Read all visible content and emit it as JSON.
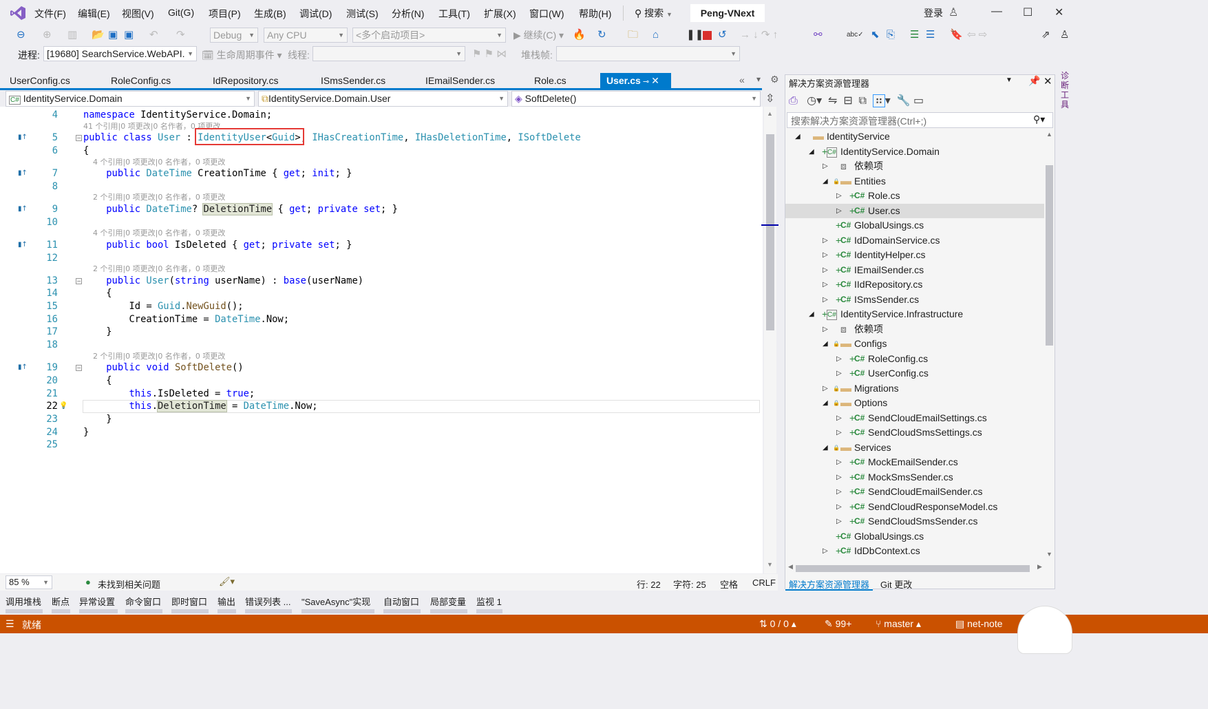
{
  "colors": {
    "accent": "#007acc",
    "status_bar": "#ca5100",
    "keyword": "#0000ff",
    "type": "#2b91af",
    "highlight_box": "#e53935"
  },
  "menu": [
    "文件(F)",
    "编辑(E)",
    "视图(V)",
    "Git(G)",
    "项目(P)",
    "生成(B)",
    "调试(D)",
    "测试(S)",
    "分析(N)",
    "工具(T)",
    "扩展(X)",
    "窗口(W)",
    "帮助(H)"
  ],
  "search_label": "搜索",
  "window_title": "Peng-VNext",
  "login": "登录",
  "toolbar": {
    "config": "Debug",
    "platform": "Any CPU",
    "startup": "<多个启动项目>",
    "continue": "继续(C)"
  },
  "debugbar": {
    "process_label": "进程:",
    "process_value": "[19680] SearchService.WebAPI.",
    "lifecycle": "生命周期事件",
    "thread_label": "线程:",
    "stackframe_label": "堆栈帧:"
  },
  "tabs": [
    {
      "label": "UserConfig.cs"
    },
    {
      "label": "RoleConfig.cs"
    },
    {
      "label": "IdRepository.cs"
    },
    {
      "label": "ISmsSender.cs"
    },
    {
      "label": "IEmailSender.cs"
    },
    {
      "label": "Role.cs"
    },
    {
      "label": "User.cs",
      "active": true
    }
  ],
  "navbar": {
    "project": "IdentityService.Domain",
    "type": "IdentityService.Domain.User",
    "member": "SoftDelete()"
  },
  "code": [
    {
      "n": 4,
      "tokens": [
        [
          "k",
          "namespace"
        ],
        [
          "p",
          " IdentityService.Domain;"
        ]
      ]
    },
    {
      "lens": "41 个引用|0 项更改|0 名作者，0 项更改",
      "n": 5,
      "icon": "implements",
      "fold": true,
      "tokens": [
        [
          "k",
          "public"
        ],
        [
          "p",
          " "
        ],
        [
          "k",
          "class"
        ],
        [
          "p",
          " "
        ],
        [
          "t",
          "User"
        ],
        [
          "p",
          " : "
        ],
        [
          "t",
          "IdentityUser"
        ],
        [
          "p",
          "<"
        ],
        [
          "t",
          "Guid"
        ],
        [
          "p",
          ">, "
        ],
        [
          "t",
          "IHasCreationTime"
        ],
        [
          "p",
          ", "
        ],
        [
          "t",
          "IHasDeletionTime"
        ],
        [
          "p",
          ", "
        ],
        [
          "t",
          "ISoftDelete"
        ]
      ]
    },
    {
      "n": 6,
      "tokens": [
        [
          "p",
          "{"
        ]
      ]
    },
    {
      "lens": "    4 个引用|0 项更改|0 名作者，0 项更改",
      "n": 7,
      "icon": "implements",
      "tokens": [
        [
          "p",
          "    "
        ],
        [
          "k",
          "public"
        ],
        [
          "p",
          " "
        ],
        [
          "t",
          "DateTime"
        ],
        [
          "p",
          " CreationTime { "
        ],
        [
          "k",
          "get"
        ],
        [
          "p",
          "; "
        ],
        [
          "k",
          "init"
        ],
        [
          "p",
          "; }"
        ]
      ]
    },
    {
      "n": 8,
      "tokens": []
    },
    {
      "lens": "    2 个引用|0 项更改|0 名作者，0 项更改",
      "n": 9,
      "icon": "implements",
      "tokens": [
        [
          "p",
          "    "
        ],
        [
          "k",
          "public"
        ],
        [
          "p",
          " "
        ],
        [
          "t",
          "DateTime"
        ],
        [
          "p",
          "? "
        ],
        [
          "hl",
          "DeletionTime"
        ],
        [
          "p",
          " { "
        ],
        [
          "k",
          "get"
        ],
        [
          "p",
          "; "
        ],
        [
          "k",
          "private"
        ],
        [
          "p",
          " "
        ],
        [
          "k",
          "set"
        ],
        [
          "p",
          "; }"
        ]
      ]
    },
    {
      "n": 10,
      "tokens": []
    },
    {
      "lens": "    4 个引用|0 项更改|0 名作者，0 项更改",
      "n": 11,
      "icon": "implements",
      "tokens": [
        [
          "p",
          "    "
        ],
        [
          "k",
          "public"
        ],
        [
          "p",
          " "
        ],
        [
          "k",
          "bool"
        ],
        [
          "p",
          " IsDeleted { "
        ],
        [
          "k",
          "get"
        ],
        [
          "p",
          "; "
        ],
        [
          "k",
          "private"
        ],
        [
          "p",
          " "
        ],
        [
          "k",
          "set"
        ],
        [
          "p",
          "; }"
        ]
      ]
    },
    {
      "n": 12,
      "tokens": []
    },
    {
      "lens": "    2 个引用|0 项更改|0 名作者，0 项更改",
      "n": 13,
      "fold": true,
      "tokens": [
        [
          "p",
          "    "
        ],
        [
          "k",
          "public"
        ],
        [
          "p",
          " "
        ],
        [
          "t",
          "User"
        ],
        [
          "p",
          "("
        ],
        [
          "k",
          "string"
        ],
        [
          "p",
          " userName) : "
        ],
        [
          "k",
          "base"
        ],
        [
          "p",
          "(userName)"
        ]
      ]
    },
    {
      "n": 14,
      "tokens": [
        [
          "p",
          "    {"
        ]
      ]
    },
    {
      "n": 15,
      "tokens": [
        [
          "p",
          "        Id = "
        ],
        [
          "t",
          "Guid"
        ],
        [
          "p",
          "."
        ],
        [
          "m",
          "NewGuid"
        ],
        [
          "p",
          "();"
        ]
      ]
    },
    {
      "n": 16,
      "tokens": [
        [
          "p",
          "        CreationTime = "
        ],
        [
          "t",
          "DateTime"
        ],
        [
          "p",
          ".Now;"
        ]
      ]
    },
    {
      "n": 17,
      "tokens": [
        [
          "p",
          "    }"
        ]
      ]
    },
    {
      "n": 18,
      "tokens": []
    },
    {
      "lens": "    2 个引用|0 项更改|0 名作者，0 项更改",
      "n": 19,
      "icon": "implements",
      "fold": true,
      "tokens": [
        [
          "p",
          "    "
        ],
        [
          "k",
          "public"
        ],
        [
          "p",
          " "
        ],
        [
          "k",
          "void"
        ],
        [
          "p",
          " "
        ],
        [
          "m",
          "SoftDelete"
        ],
        [
          "p",
          "()"
        ]
      ]
    },
    {
      "n": 20,
      "tokens": [
        [
          "p",
          "    {"
        ]
      ]
    },
    {
      "n": 21,
      "tokens": [
        [
          "p",
          "        "
        ],
        [
          "k",
          "this"
        ],
        [
          "p",
          ".IsDeleted = "
        ],
        [
          "k",
          "true"
        ],
        [
          "p",
          ";"
        ]
      ]
    },
    {
      "n": 22,
      "current": true,
      "icon": "lightbulb",
      "tokens": [
        [
          "p",
          "        "
        ],
        [
          "k",
          "this"
        ],
        [
          "p",
          "."
        ],
        [
          "hl",
          "DeletionTime"
        ],
        [
          "p",
          " = "
        ],
        [
          "t",
          "DateTime"
        ],
        [
          "p",
          ".Now;"
        ]
      ]
    },
    {
      "n": 23,
      "tokens": [
        [
          "p",
          "    }"
        ]
      ]
    },
    {
      "n": 24,
      "tokens": [
        [
          "p",
          "}"
        ]
      ]
    },
    {
      "n": 25,
      "tokens": []
    }
  ],
  "editor_status": {
    "zoom": "85 %",
    "issues": "未找到相关问题",
    "line": "行: 22",
    "col": "字符: 25",
    "spaces": "空格",
    "eol": "CRLF"
  },
  "solution_explorer": {
    "title": "解决方案资源管理器",
    "search_placeholder": "搜索解决方案资源管理器(Ctrl+;)",
    "items": [
      {
        "label": "IdentityService",
        "level": 0,
        "state": "expanded",
        "icon": "folder"
      },
      {
        "label": "IdentityService.Domain",
        "level": 1,
        "state": "expanded",
        "icon": "csproj",
        "plus": true
      },
      {
        "label": "依赖项",
        "level": 2,
        "state": "collapsed",
        "icon": "dependencies"
      },
      {
        "label": "Entities",
        "level": 2,
        "state": "expanded",
        "icon": "folder",
        "lock": true
      },
      {
        "label": "Role.cs",
        "level": 3,
        "state": "collapsed",
        "icon": "cs",
        "plus": true
      },
      {
        "label": "User.cs",
        "level": 3,
        "state": "collapsed",
        "icon": "cs",
        "plus": true,
        "selected": true
      },
      {
        "label": "GlobalUsings.cs",
        "level": 2,
        "state": "none",
        "icon": "cs",
        "plus": true
      },
      {
        "label": "IdDomainService.cs",
        "level": 2,
        "state": "collapsed",
        "icon": "cs",
        "plus": true
      },
      {
        "label": "IdentityHelper.cs",
        "level": 2,
        "state": "collapsed",
        "icon": "cs",
        "plus": true
      },
      {
        "label": "IEmailSender.cs",
        "level": 2,
        "state": "collapsed",
        "icon": "cs",
        "plus": true
      },
      {
        "label": "IIdRepository.cs",
        "level": 2,
        "state": "collapsed",
        "icon": "cs",
        "plus": true
      },
      {
        "label": "ISmsSender.cs",
        "level": 2,
        "state": "collapsed",
        "icon": "cs",
        "plus": true
      },
      {
        "label": "IdentityService.Infrastructure",
        "level": 1,
        "state": "expanded",
        "icon": "csproj",
        "plus": true
      },
      {
        "label": "依赖项",
        "level": 2,
        "state": "collapsed",
        "icon": "dependencies"
      },
      {
        "label": "Configs",
        "level": 2,
        "state": "expanded",
        "icon": "folder",
        "lock": true
      },
      {
        "label": "RoleConfig.cs",
        "level": 3,
        "state": "collapsed",
        "icon": "cs",
        "plus": true
      },
      {
        "label": "UserConfig.cs",
        "level": 3,
        "state": "collapsed",
        "icon": "cs",
        "plus": true
      },
      {
        "label": "Migrations",
        "level": 2,
        "state": "collapsed",
        "icon": "folder",
        "lock": true
      },
      {
        "label": "Options",
        "level": 2,
        "state": "expanded",
        "icon": "folder",
        "lock": true
      },
      {
        "label": "SendCloudEmailSettings.cs",
        "level": 3,
        "state": "collapsed",
        "icon": "cs",
        "plus": true
      },
      {
        "label": "SendCloudSmsSettings.cs",
        "level": 3,
        "state": "collapsed",
        "icon": "cs",
        "plus": true
      },
      {
        "label": "Services",
        "level": 2,
        "state": "expanded",
        "icon": "folder",
        "lock": true
      },
      {
        "label": "MockEmailSender.cs",
        "level": 3,
        "state": "collapsed",
        "icon": "cs",
        "plus": true
      },
      {
        "label": "MockSmsSender.cs",
        "level": 3,
        "state": "collapsed",
        "icon": "cs",
        "plus": true
      },
      {
        "label": "SendCloudEmailSender.cs",
        "level": 3,
        "state": "collapsed",
        "icon": "cs",
        "plus": true
      },
      {
        "label": "SendCloudResponseModel.cs",
        "level": 3,
        "state": "collapsed",
        "icon": "cs",
        "plus": true
      },
      {
        "label": "SendCloudSmsSender.cs",
        "level": 3,
        "state": "collapsed",
        "icon": "cs",
        "plus": true
      },
      {
        "label": "GlobalUsings.cs",
        "level": 2,
        "state": "none",
        "icon": "cs",
        "plus": true
      },
      {
        "label": "IdDbContext.cs",
        "level": 2,
        "state": "collapsed",
        "icon": "cs",
        "plus": true
      }
    ],
    "bottom_tabs": [
      "解决方案资源管理器",
      "Git 更改"
    ]
  },
  "side_tool": "诊断工具",
  "bottom_tools": [
    "调用堆栈",
    "断点",
    "异常设置",
    "命令窗口",
    "即时窗口",
    "输出",
    "错误列表 ...",
    "\"SaveAsync\"实现",
    "自动窗口",
    "局部变量",
    "监视 1"
  ],
  "statusbar": {
    "ready": "就绪",
    "sync": "0 / 0",
    "changes": "99+",
    "branch": "master",
    "repo": "net-note"
  }
}
